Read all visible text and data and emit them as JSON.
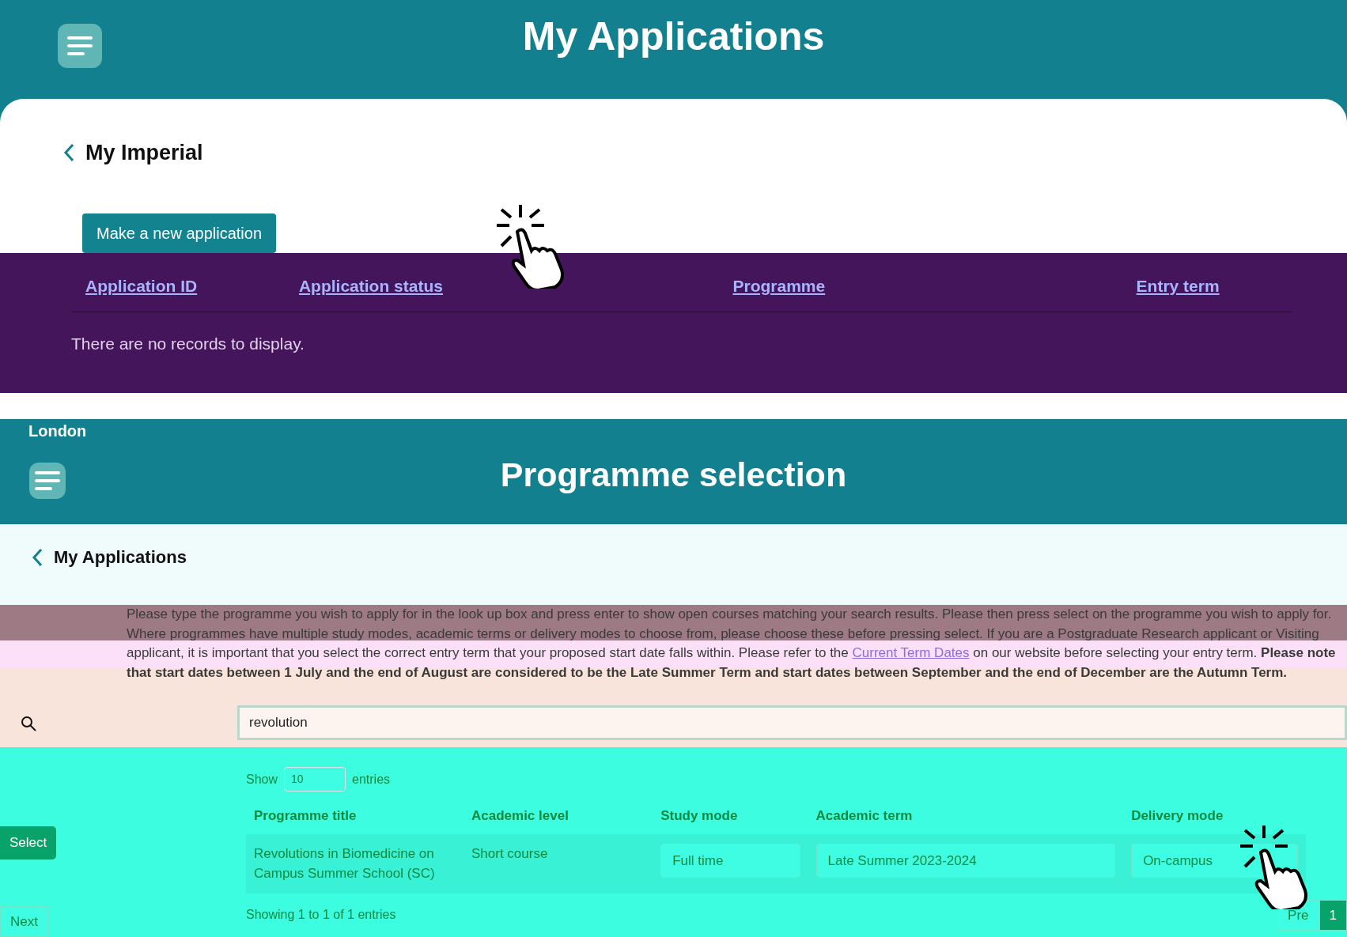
{
  "applications_page": {
    "title": "My Applications",
    "back_link": "My Imperial",
    "new_button": "Make a new application",
    "table": {
      "columns": [
        "Application ID",
        "Application status",
        "Programme",
        "Entry term"
      ],
      "empty_message": "There are no records to display."
    }
  },
  "programme_page": {
    "brand_fragment": "London",
    "title": "Programme selection",
    "back_link": "My Applications",
    "instructions": {
      "before": "Please type the programme you wish to apply for in the look up box and press enter to show open courses matching your search results. Please then press select on the programme you wish to apply for. Where programmes have multiple study modes, academic terms or delivery modes to choose from, please choose these before pressing select. If you are a Postgraduate Research applicant or Visiting applicant, it is important that you select the correct entry term that your proposed start date falls within. Please refer to the",
      "link": "Current Term Dates",
      "after": "on our website before selecting your entry term. **Please note that start dates between 1 July and the end of August are considered to be the Late Summer Term and start dates between September and the end of December are the Autumn Term.**"
    },
    "search": {
      "value": "revolution"
    },
    "length": {
      "before": "Show",
      "value": "10",
      "after": "entries"
    },
    "table": {
      "columns": [
        "Programme title",
        "Academic level",
        "Study mode",
        "Academic term",
        "Delivery mode"
      ],
      "rows": [
        {
          "title": "Revolutions in Biomedicine on Campus Summer School (SC)",
          "level": "Short course",
          "study_mode": "Full time",
          "academic_term": "Late Summer 2023-2024",
          "delivery_mode": "On-campus"
        }
      ]
    },
    "info": "Showing 1 to 1 of 1 entries",
    "pagination": [
      {
        "label": "Pre",
        "selected": false
      },
      {
        "label": "1",
        "selected": true
      }
    ],
    "left_fragments": {
      "select_button": "Select",
      "next_link": "Next"
    }
  }
}
